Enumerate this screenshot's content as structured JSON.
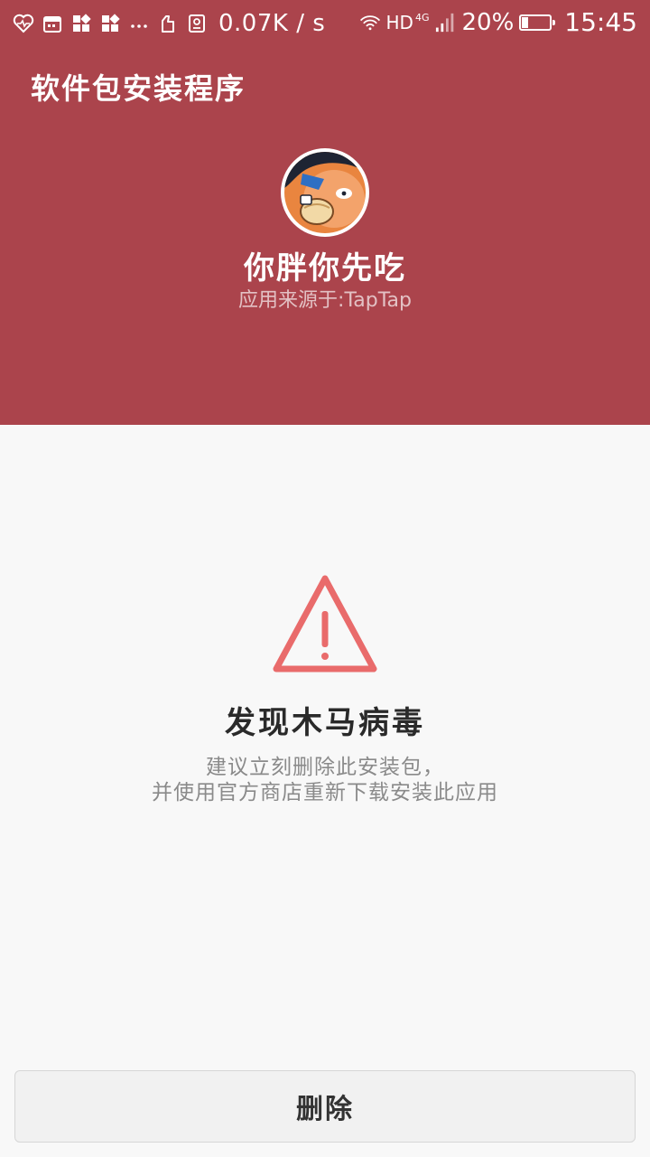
{
  "status_bar": {
    "net_speed": "0.07K / s",
    "hd_label": "HD",
    "network_type": "4G",
    "battery_percent": "20%",
    "battery_level": 0.2,
    "time": "15:45",
    "left_icons": [
      "heartbeat-icon",
      "calendar-icon",
      "apps-icon",
      "apps-icon",
      "more-dots-icon",
      "glove-icon",
      "portrait-icon"
    ],
    "right_icons": [
      "wifi-icon",
      "signal-icon",
      "battery-icon"
    ]
  },
  "header": {
    "title": "软件包安装程序",
    "background_color": "#ab444c",
    "app_icon": "app-avatar-icon",
    "app_name": "你胖你先吃",
    "app_source": "应用来源于:TapTap"
  },
  "warning": {
    "icon": "warning-triangle-icon",
    "icon_color": "#e96b6b",
    "title": "发现木马病毒",
    "desc_line1": "建议立刻删除此安装包，",
    "desc_line2": "并使用官方商店重新下载安装此应用"
  },
  "actions": {
    "delete_label": "删除"
  }
}
